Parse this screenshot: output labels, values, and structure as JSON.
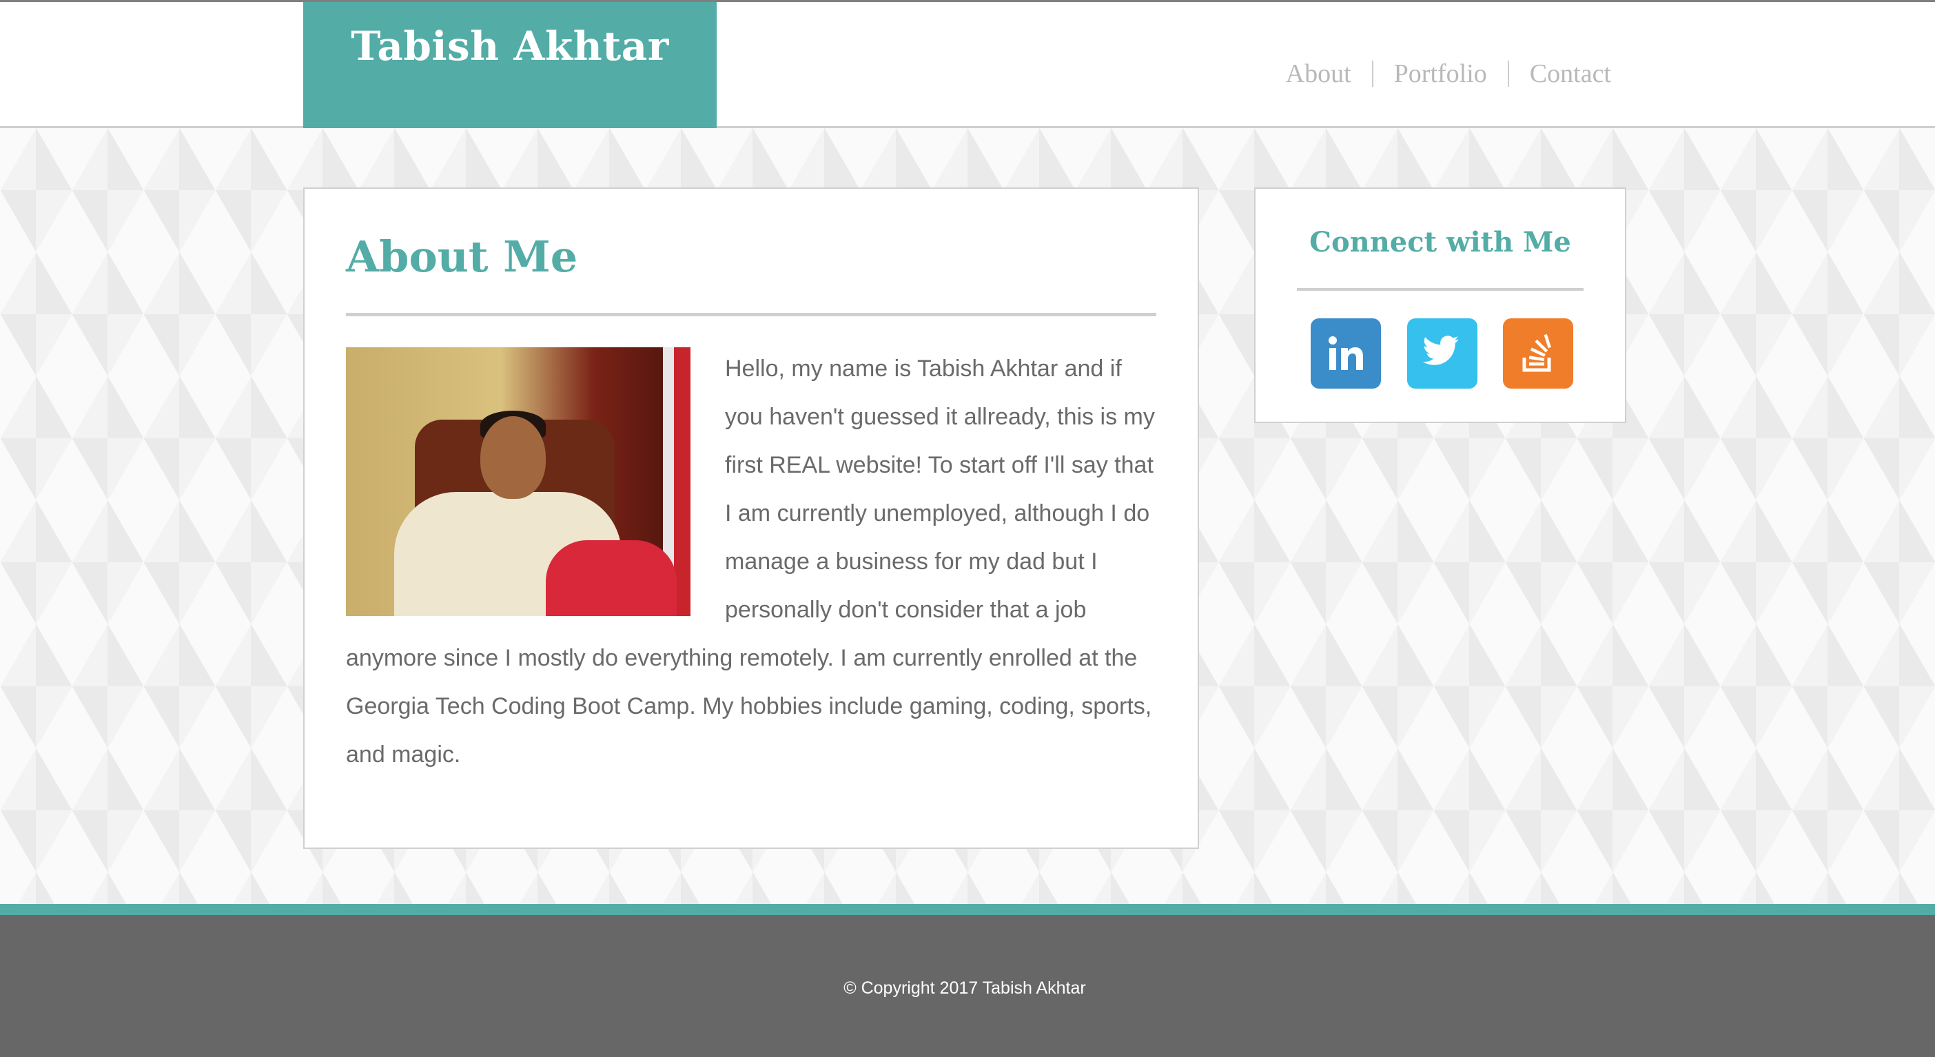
{
  "header": {
    "brand": "Tabish Akhtar",
    "nav": [
      "About",
      "Portfolio",
      "Contact"
    ]
  },
  "about": {
    "title": "About Me",
    "text": "Hello, my name is Tabish Akhtar and if you haven't guessed it allready, this is my first REAL website! To start off I'll say that I am currently unemployed, although I do manage a business for my dad but I personally don't consider that a job anymore since I mostly do everything remotely. I am currently enrolled at the Georgia Tech Coding Boot Camp. My hobbies include gaming, coding, sports, and magic."
  },
  "connect": {
    "title": "Connect with Me",
    "icons": [
      "linkedin-icon",
      "twitter-icon",
      "stack-overflow-icon"
    ]
  },
  "footer": {
    "copyright": "© Copyright 2017 Tabish Akhtar"
  },
  "colors": {
    "accent": "#53aca6",
    "footer": "#676767",
    "linkedin": "#3b8dc9",
    "twitter": "#35c0ee",
    "stackoverflow": "#f07d2a"
  }
}
